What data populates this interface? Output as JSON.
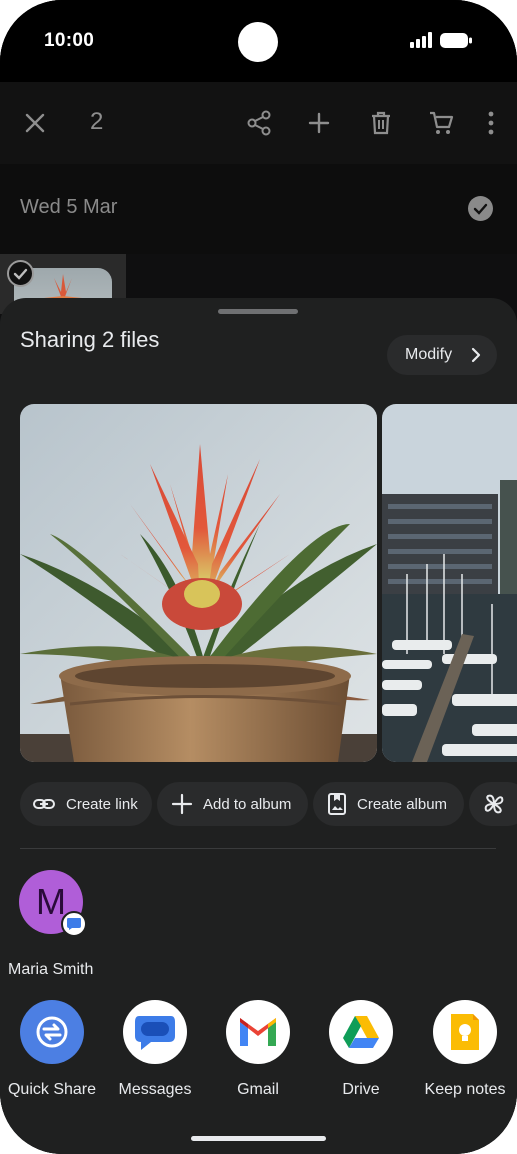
{
  "status": {
    "time": "10:00"
  },
  "selection": {
    "count": "2",
    "date": "Wed 5 Mar"
  },
  "sheet": {
    "title": "Sharing 2 files",
    "modify_label": "Modify"
  },
  "actions": [
    {
      "label": "Create link",
      "icon": "link-icon"
    },
    {
      "label": "Add to album",
      "icon": "plus-icon"
    },
    {
      "label": "Create album",
      "icon": "album-icon"
    },
    {
      "label": "",
      "icon": "pinwheel-icon"
    }
  ],
  "contact": {
    "initial": "M",
    "name": "Maria Smith",
    "badge_icon": "messages-badge-icon"
  },
  "apps": [
    {
      "label": "Quick Share",
      "icon": "quick-share-icon"
    },
    {
      "label": "Messages",
      "icon": "messages-icon"
    },
    {
      "label": "Gmail",
      "icon": "gmail-icon"
    },
    {
      "label": "Drive",
      "icon": "drive-icon"
    },
    {
      "label": "Keep notes",
      "icon": "keep-notes-icon"
    }
  ],
  "colors": {
    "sheet_bg": "#1f2020",
    "chip_bg": "#2a2b2c",
    "avatar": "#b05ed8",
    "quick_share": "#4c7fe3",
    "messages": "#3d7ce8"
  }
}
